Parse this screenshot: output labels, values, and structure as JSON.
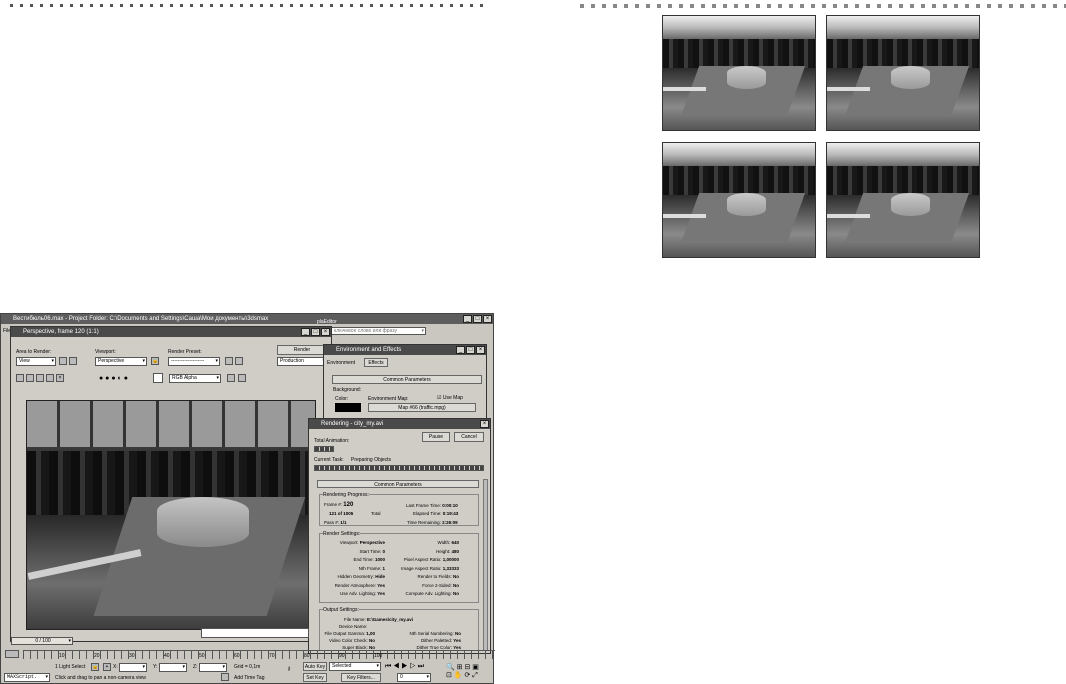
{
  "max": {
    "title": "Вестибюль06.max - Project Folder: C:\\Documents and Settings\\Саша\\Мои документы\\3dsmax",
    "menu_file": "File",
    "search_placeholder": "ключевое слово или фразу",
    "frame_window": {
      "title": "Perspective, frame 120 (1:1)",
      "area_label": "Area to Render:",
      "area_value": "View",
      "viewport_label": "Viewport:",
      "viewport_value": "Perspective",
      "preset_label": "Render Preset:",
      "preset_value": "--------------------",
      "render_button": "Render",
      "production_value": "Production",
      "channel_value": "RGB Alpha"
    },
    "env_window": {
      "title": "Environment and Effects",
      "tab_env": "Environment",
      "tab_effects": "Effects",
      "rollout": "Common Parameters",
      "background": "Background:",
      "color": "Color:",
      "env_map": "Environment Map:",
      "use_map": "Use Map",
      "map_name": "Map #66 (traffic.mpg)",
      "partial_title": "plaEditor"
    },
    "rendering_window": {
      "title": "Rendering - city_my.avi",
      "total_animation": "Total Animation:",
      "pause": "Pause",
      "cancel": "Cancel",
      "current_task": "Current Task:",
      "task_value": "Preparing Objects",
      "rollout": "Common Parameters",
      "progress_title": "Rendering Progress:",
      "frame_label": "Frame #:",
      "frame_value": "120",
      "of_value": "121 of 1005",
      "total": "Total",
      "pass_label": "Pass #:",
      "pass_value": "1/1",
      "last_frame_label": "Last Frame Time:",
      "last_frame_value": "0:00:10",
      "elapsed_label": "Elapsed Time:",
      "elapsed_value": "0:19:43",
      "remaining_label": "Time Remaining:",
      "remaining_value": "2:26:09",
      "settings_title": "Render Settings:",
      "left_settings": [
        {
          "k": "Viewport:",
          "v": "Perspective"
        },
        {
          "k": "Start Time:",
          "v": "0"
        },
        {
          "k": "End Time:",
          "v": "1000"
        },
        {
          "k": "Nth Frame:",
          "v": "1"
        },
        {
          "k": "Hidden Geometry:",
          "v": "Hide"
        },
        {
          "k": "Render Atmosphere:",
          "v": "Yes"
        },
        {
          "k": "Use Adv. Lighting:",
          "v": "Yes"
        }
      ],
      "right_settings": [
        {
          "k": "Width:",
          "v": "640"
        },
        {
          "k": "Height:",
          "v": "480"
        },
        {
          "k": "Pixel Aspect Ratio:",
          "v": "1,00000"
        },
        {
          "k": "Image Aspect Ratio:",
          "v": "1,33333"
        },
        {
          "k": "Render to Fields:",
          "v": "No"
        },
        {
          "k": "Force 2-Sided:",
          "v": "No"
        },
        {
          "k": "Compute Adv. Lighting:",
          "v": "No"
        }
      ],
      "output_title": "Output Settings:",
      "file_name_label": "File Name:",
      "file_name_value": "E:\\Games\\city_my.avi",
      "device_label": "Device Name:",
      "output_left": [
        {
          "k": "File Output Gamma:",
          "v": "1,00"
        },
        {
          "k": "Video Color Check:",
          "v": "No"
        },
        {
          "k": "Super Black:",
          "v": "No"
        }
      ],
      "output_right": [
        {
          "k": "Nth Serial Numbering:",
          "v": "No"
        },
        {
          "k": "Dither Paletted:",
          "v": "Yes"
        },
        {
          "k": "Dither True Color:",
          "v": "Yes"
        }
      ]
    },
    "timeline": {
      "counter": "0 / 100",
      "ticks": [
        "10",
        "20",
        "30",
        "40",
        "50",
        "60",
        "70",
        "80",
        "90",
        "100"
      ]
    },
    "status": {
      "selection": "1 Light Select",
      "x": "X:",
      "y": "Y:",
      "z": "Z:",
      "grid": "Grid = 0,1m",
      "auto_key": "Auto Key",
      "selected": "Selected",
      "set_key": "Set Key",
      "key_filters": "Key Filters...",
      "frame_field": "0",
      "maxscript": "MAXScript.",
      "hint": "Click and drag to pan a non-camera view",
      "add_time_tag": "Add Time Tag"
    }
  },
  "thumbnails_count": 4
}
